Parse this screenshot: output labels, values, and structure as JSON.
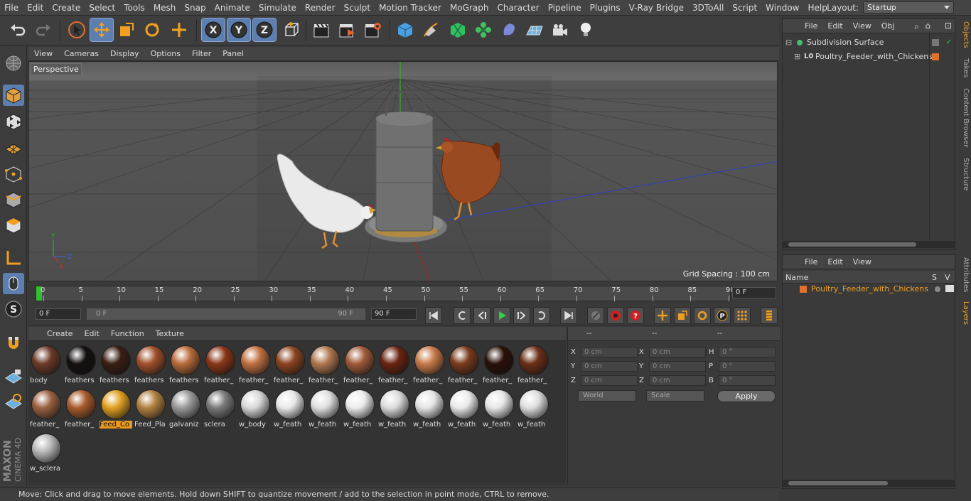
{
  "menubar": {
    "items": [
      "File",
      "Edit",
      "Create",
      "Select",
      "Tools",
      "Mesh",
      "Snap",
      "Animate",
      "Simulate",
      "Render",
      "Sculpt",
      "Motion Tracker",
      "MoGraph",
      "Character",
      "Pipeline",
      "Plugins",
      "V-Ray Bridge",
      "3DToAll",
      "Script",
      "Window",
      "Help"
    ],
    "layout_label": "Layout:",
    "layout_value": "Startup"
  },
  "viewport": {
    "menu": [
      "View",
      "Cameras",
      "Display",
      "Options",
      "Filter",
      "Panel"
    ],
    "label": "Perspective",
    "grid_spacing": "Grid Spacing : 100 cm"
  },
  "timeline": {
    "ticks": [
      "0",
      "5",
      "10",
      "15",
      "20",
      "25",
      "30",
      "35",
      "40",
      "45",
      "50",
      "55",
      "60",
      "65",
      "70",
      "75",
      "80",
      "85",
      "90"
    ],
    "current_frame": "0 F",
    "start_field": "0 F",
    "range_start": "0 F",
    "range_end": "90 F",
    "end_field": "90 F"
  },
  "materials": {
    "menu": [
      "Create",
      "Edit",
      "Function",
      "Texture"
    ],
    "items": [
      {
        "name": "body",
        "color": "#6b3a28"
      },
      {
        "name": "feathers",
        "color": "#151010"
      },
      {
        "name": "feathers",
        "color": "#3a1e14"
      },
      {
        "name": "feathers",
        "color": "#a0502a"
      },
      {
        "name": "feathers",
        "color": "#b86a3a"
      },
      {
        "name": "feather_",
        "color": "#8a3618"
      },
      {
        "name": "feather_",
        "color": "#c07040"
      },
      {
        "name": "feather_",
        "color": "#8a4420"
      },
      {
        "name": "feather_",
        "color": "#b07850"
      },
      {
        "name": "feather_",
        "color": "#a05a38"
      },
      {
        "name": "feather_",
        "color": "#6a2410"
      },
      {
        "name": "feather_",
        "color": "#c87a48"
      },
      {
        "name": "feather_",
        "color": "#7a3a1c"
      },
      {
        "name": "feather_",
        "color": "#2a1008"
      },
      {
        "name": "feather_",
        "color": "#6a3016"
      },
      {
        "name": "feather_",
        "color": "#9a6040"
      },
      {
        "name": "feather_",
        "color": "#a85a2c"
      },
      {
        "name": "Feed_Co",
        "color": "#e0a020"
      },
      {
        "name": "Feed_Pla",
        "color": "#b08040"
      },
      {
        "name": "galvaniz",
        "color": "#9a9a9a"
      },
      {
        "name": "sclera",
        "color": "#7a7a7a"
      },
      {
        "name": "w_body",
        "color": "#d8d8d8"
      },
      {
        "name": "w_feath",
        "color": "#e8e8e8"
      },
      {
        "name": "w_feath",
        "color": "#e0e0e0"
      },
      {
        "name": "w_feath",
        "color": "#ececec"
      },
      {
        "name": "w_feath",
        "color": "#dcdcdc"
      },
      {
        "name": "w_feath",
        "color": "#e4e4e4"
      },
      {
        "name": "w_feath",
        "color": "#eaeaea"
      },
      {
        "name": "w_feath",
        "color": "#e6e6e6"
      },
      {
        "name": "w_feath",
        "color": "#dedede"
      },
      {
        "name": "w_sclera",
        "color": "#b8b8b8"
      }
    ],
    "selected_index": 17
  },
  "coords": {
    "headers": [
      "--",
      "--",
      "--"
    ],
    "rows": [
      {
        "a": "X",
        "av": "0 cm",
        "b": "X",
        "bv": "0 cm",
        "c": "H",
        "cv": "0 °"
      },
      {
        "a": "Y",
        "av": "0 cm",
        "b": "Y",
        "bv": "0 cm",
        "c": "P",
        "cv": "0 °"
      },
      {
        "a": "Z",
        "av": "0 cm",
        "b": "Z",
        "bv": "0 cm",
        "c": "B",
        "cv": "0 °"
      }
    ],
    "world": "World",
    "scale": "Scale",
    "apply": "Apply"
  },
  "objects": {
    "menu": [
      "File",
      "Edit",
      "View",
      "Obj"
    ],
    "items": [
      "Subdivision Surface",
      "Poultry_Feeder_with_Chickens"
    ]
  },
  "layers": {
    "menu": [
      "File",
      "Edit",
      "View"
    ],
    "col_name": "Name",
    "col_s": "S",
    "col_v": "V",
    "items": [
      "Poultry_Feeder_with_Chickens"
    ]
  },
  "sidetabs": [
    "Objects",
    "Takes",
    "Content Browser",
    "Structure",
    "Attributes",
    "Layers"
  ],
  "status": "Move: Click and drag to move elements. Hold down SHIFT to quantize movement / add to the selection in point mode, CTRL to remove.",
  "branding": {
    "maxon": "MAXON",
    "cinema": "CINEMA 4D"
  },
  "colors": {
    "accent": "#5c7fb0",
    "orange": "#e89a1e",
    "layer": "#e0702a"
  }
}
